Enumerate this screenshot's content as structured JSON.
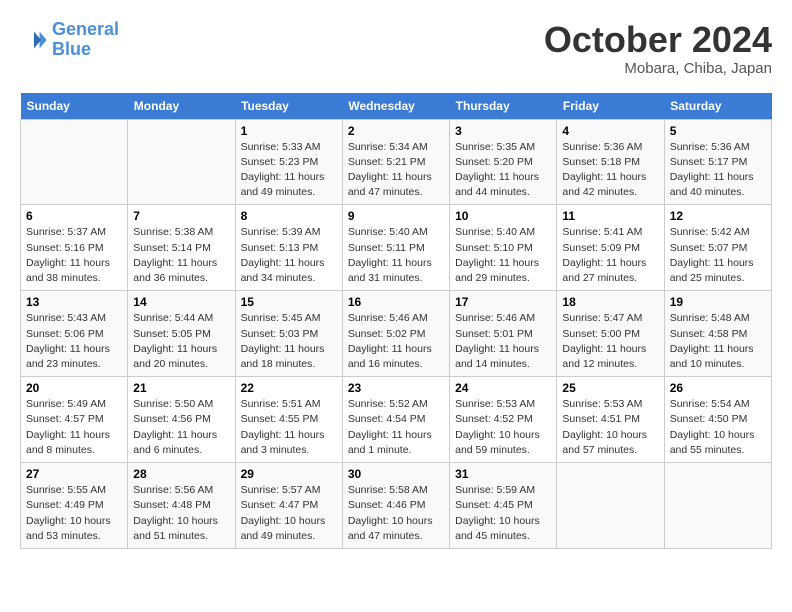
{
  "header": {
    "logo_line1": "General",
    "logo_line2": "Blue",
    "month": "October 2024",
    "location": "Mobara, Chiba, Japan"
  },
  "weekdays": [
    "Sunday",
    "Monday",
    "Tuesday",
    "Wednesday",
    "Thursday",
    "Friday",
    "Saturday"
  ],
  "weeks": [
    [
      {
        "day": "",
        "empty": true
      },
      {
        "day": "",
        "empty": true
      },
      {
        "day": "1",
        "sunrise": "Sunrise: 5:33 AM",
        "sunset": "Sunset: 5:23 PM",
        "daylight": "Daylight: 11 hours and 49 minutes."
      },
      {
        "day": "2",
        "sunrise": "Sunrise: 5:34 AM",
        "sunset": "Sunset: 5:21 PM",
        "daylight": "Daylight: 11 hours and 47 minutes."
      },
      {
        "day": "3",
        "sunrise": "Sunrise: 5:35 AM",
        "sunset": "Sunset: 5:20 PM",
        "daylight": "Daylight: 11 hours and 44 minutes."
      },
      {
        "day": "4",
        "sunrise": "Sunrise: 5:36 AM",
        "sunset": "Sunset: 5:18 PM",
        "daylight": "Daylight: 11 hours and 42 minutes."
      },
      {
        "day": "5",
        "sunrise": "Sunrise: 5:36 AM",
        "sunset": "Sunset: 5:17 PM",
        "daylight": "Daylight: 11 hours and 40 minutes."
      }
    ],
    [
      {
        "day": "6",
        "sunrise": "Sunrise: 5:37 AM",
        "sunset": "Sunset: 5:16 PM",
        "daylight": "Daylight: 11 hours and 38 minutes."
      },
      {
        "day": "7",
        "sunrise": "Sunrise: 5:38 AM",
        "sunset": "Sunset: 5:14 PM",
        "daylight": "Daylight: 11 hours and 36 minutes."
      },
      {
        "day": "8",
        "sunrise": "Sunrise: 5:39 AM",
        "sunset": "Sunset: 5:13 PM",
        "daylight": "Daylight: 11 hours and 34 minutes."
      },
      {
        "day": "9",
        "sunrise": "Sunrise: 5:40 AM",
        "sunset": "Sunset: 5:11 PM",
        "daylight": "Daylight: 11 hours and 31 minutes."
      },
      {
        "day": "10",
        "sunrise": "Sunrise: 5:40 AM",
        "sunset": "Sunset: 5:10 PM",
        "daylight": "Daylight: 11 hours and 29 minutes."
      },
      {
        "day": "11",
        "sunrise": "Sunrise: 5:41 AM",
        "sunset": "Sunset: 5:09 PM",
        "daylight": "Daylight: 11 hours and 27 minutes."
      },
      {
        "day": "12",
        "sunrise": "Sunrise: 5:42 AM",
        "sunset": "Sunset: 5:07 PM",
        "daylight": "Daylight: 11 hours and 25 minutes."
      }
    ],
    [
      {
        "day": "13",
        "sunrise": "Sunrise: 5:43 AM",
        "sunset": "Sunset: 5:06 PM",
        "daylight": "Daylight: 11 hours and 23 minutes."
      },
      {
        "day": "14",
        "sunrise": "Sunrise: 5:44 AM",
        "sunset": "Sunset: 5:05 PM",
        "daylight": "Daylight: 11 hours and 20 minutes."
      },
      {
        "day": "15",
        "sunrise": "Sunrise: 5:45 AM",
        "sunset": "Sunset: 5:03 PM",
        "daylight": "Daylight: 11 hours and 18 minutes."
      },
      {
        "day": "16",
        "sunrise": "Sunrise: 5:46 AM",
        "sunset": "Sunset: 5:02 PM",
        "daylight": "Daylight: 11 hours and 16 minutes."
      },
      {
        "day": "17",
        "sunrise": "Sunrise: 5:46 AM",
        "sunset": "Sunset: 5:01 PM",
        "daylight": "Daylight: 11 hours and 14 minutes."
      },
      {
        "day": "18",
        "sunrise": "Sunrise: 5:47 AM",
        "sunset": "Sunset: 5:00 PM",
        "daylight": "Daylight: 11 hours and 12 minutes."
      },
      {
        "day": "19",
        "sunrise": "Sunrise: 5:48 AM",
        "sunset": "Sunset: 4:58 PM",
        "daylight": "Daylight: 11 hours and 10 minutes."
      }
    ],
    [
      {
        "day": "20",
        "sunrise": "Sunrise: 5:49 AM",
        "sunset": "Sunset: 4:57 PM",
        "daylight": "Daylight: 11 hours and 8 minutes."
      },
      {
        "day": "21",
        "sunrise": "Sunrise: 5:50 AM",
        "sunset": "Sunset: 4:56 PM",
        "daylight": "Daylight: 11 hours and 6 minutes."
      },
      {
        "day": "22",
        "sunrise": "Sunrise: 5:51 AM",
        "sunset": "Sunset: 4:55 PM",
        "daylight": "Daylight: 11 hours and 3 minutes."
      },
      {
        "day": "23",
        "sunrise": "Sunrise: 5:52 AM",
        "sunset": "Sunset: 4:54 PM",
        "daylight": "Daylight: 11 hours and 1 minute."
      },
      {
        "day": "24",
        "sunrise": "Sunrise: 5:53 AM",
        "sunset": "Sunset: 4:52 PM",
        "daylight": "Daylight: 10 hours and 59 minutes."
      },
      {
        "day": "25",
        "sunrise": "Sunrise: 5:53 AM",
        "sunset": "Sunset: 4:51 PM",
        "daylight": "Daylight: 10 hours and 57 minutes."
      },
      {
        "day": "26",
        "sunrise": "Sunrise: 5:54 AM",
        "sunset": "Sunset: 4:50 PM",
        "daylight": "Daylight: 10 hours and 55 minutes."
      }
    ],
    [
      {
        "day": "27",
        "sunrise": "Sunrise: 5:55 AM",
        "sunset": "Sunset: 4:49 PM",
        "daylight": "Daylight: 10 hours and 53 minutes."
      },
      {
        "day": "28",
        "sunrise": "Sunrise: 5:56 AM",
        "sunset": "Sunset: 4:48 PM",
        "daylight": "Daylight: 10 hours and 51 minutes."
      },
      {
        "day": "29",
        "sunrise": "Sunrise: 5:57 AM",
        "sunset": "Sunset: 4:47 PM",
        "daylight": "Daylight: 10 hours and 49 minutes."
      },
      {
        "day": "30",
        "sunrise": "Sunrise: 5:58 AM",
        "sunset": "Sunset: 4:46 PM",
        "daylight": "Daylight: 10 hours and 47 minutes."
      },
      {
        "day": "31",
        "sunrise": "Sunrise: 5:59 AM",
        "sunset": "Sunset: 4:45 PM",
        "daylight": "Daylight: 10 hours and 45 minutes."
      },
      {
        "day": "",
        "empty": true
      },
      {
        "day": "",
        "empty": true
      }
    ]
  ]
}
